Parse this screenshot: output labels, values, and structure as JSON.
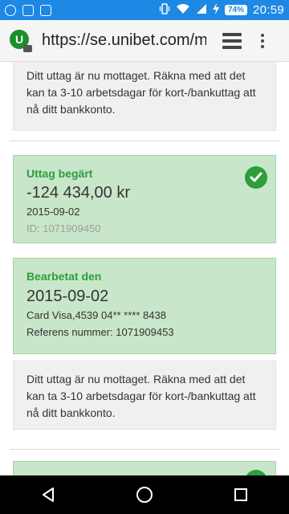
{
  "status": {
    "battery": "74%",
    "time": "20:59"
  },
  "browser": {
    "url": "https://se.unibet.com/my",
    "site_initial": "U"
  },
  "withdrawal_top": {
    "info": "Ditt uttag är nu mottaget. Räkna med att det kan ta 3-10 arbetsdagar för kort-/bankuttag att nå ditt bankkonto."
  },
  "withdrawal": {
    "request": {
      "title": "Uttag begärt",
      "amount": "-124 434,00 kr",
      "date": "2015-09-02",
      "id": "ID: 1071909450"
    },
    "processed": {
      "title": "Bearbetat den",
      "date": "2015-09-02",
      "card": "Card Visa,4539 04** **** 8438",
      "reference": "Referens nummer: 1071909453"
    },
    "info": "Ditt uttag är nu mottaget. Räkna med att det kan ta 3-10 arbetsdagar för kort-/bankuttag att nå ditt bankkonto."
  },
  "colors": {
    "accent_green": "#2e9e3a",
    "card_bg": "#c8e6c9",
    "statusbar": "#1e88e5"
  }
}
